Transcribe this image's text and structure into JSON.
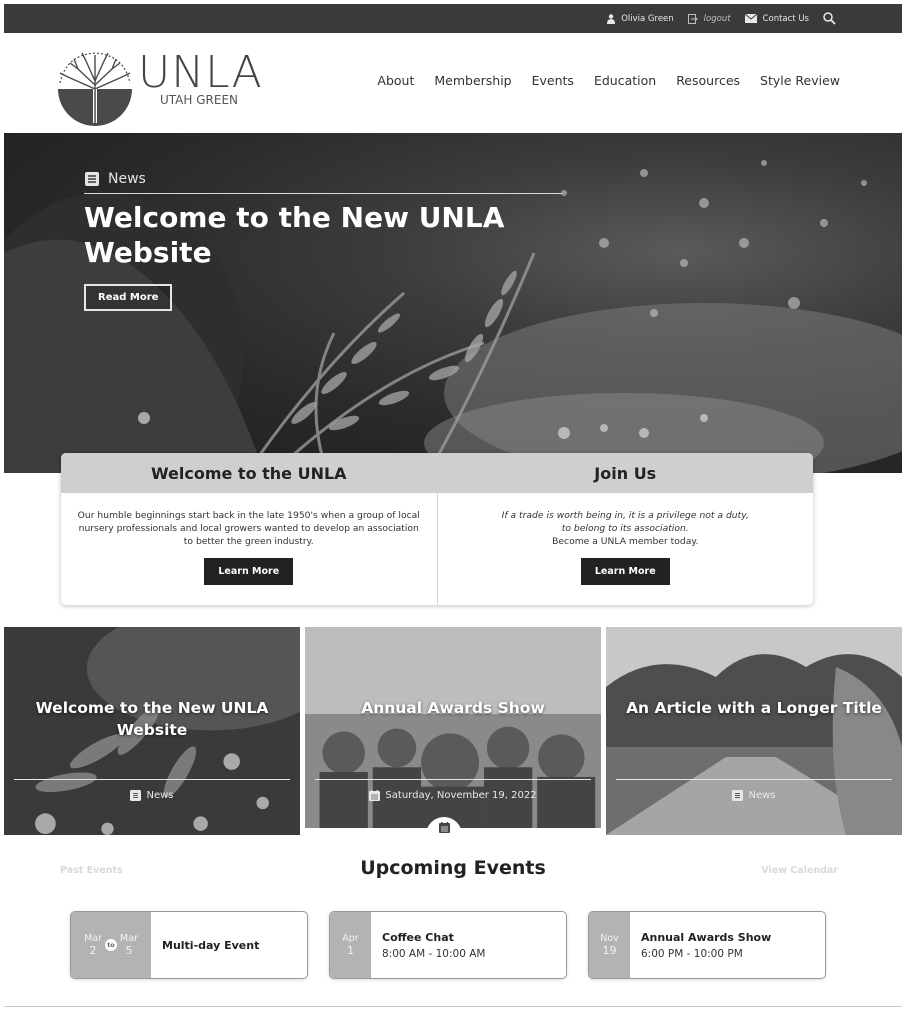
{
  "topbar": {
    "user": "Olivia Green",
    "logout": "logout",
    "contact": "Contact Us"
  },
  "logo": {
    "main": "UNLA",
    "sub": "UTAH GREEN"
  },
  "nav": [
    "About",
    "Membership",
    "Events",
    "Education",
    "Resources",
    "Style Review"
  ],
  "hero": {
    "category": "News",
    "title": "Welcome to the New UNLA Website",
    "button": "Read More"
  },
  "welcome": {
    "title": "Welcome to the UNLA",
    "text": "Our humble beginnings start back in the late 1950's when a group of local nursery professionals and local growers wanted to develop an association to better the green industry.",
    "button": "Learn More"
  },
  "join": {
    "title": "Join Us",
    "quote1": "If a trade is worth being in, it is a privilege not a duty,",
    "quote2": "to belong to its association.",
    "text": "Become a UNLA member today.",
    "button": "Learn More"
  },
  "tiles": [
    {
      "title": "Welcome to the New UNLA Website",
      "meta": "News",
      "icon": "news-icon"
    },
    {
      "title": "Annual Awards Show",
      "meta": "Saturday, November 19, 2022",
      "icon": "calendar-icon"
    },
    {
      "title": "An Article with a Longer Title",
      "meta": "News",
      "icon": "news-icon"
    }
  ],
  "events": {
    "past": "Past Events",
    "title": "Upcoming Events",
    "calendar": "View Calendar",
    "items": [
      {
        "mon1": "Mar",
        "day1": "2",
        "to": "to",
        "mon2": "Mar",
        "day2": "5",
        "name": "Multi-day Event",
        "time": ""
      },
      {
        "mon": "Apr",
        "day": "1",
        "name": "Coffee Chat",
        "time": "8:00 AM - 10:00 AM"
      },
      {
        "mon": "Nov",
        "day": "19",
        "name": "Annual Awards Show",
        "time": "6:00 PM - 10:00 PM"
      }
    ]
  }
}
